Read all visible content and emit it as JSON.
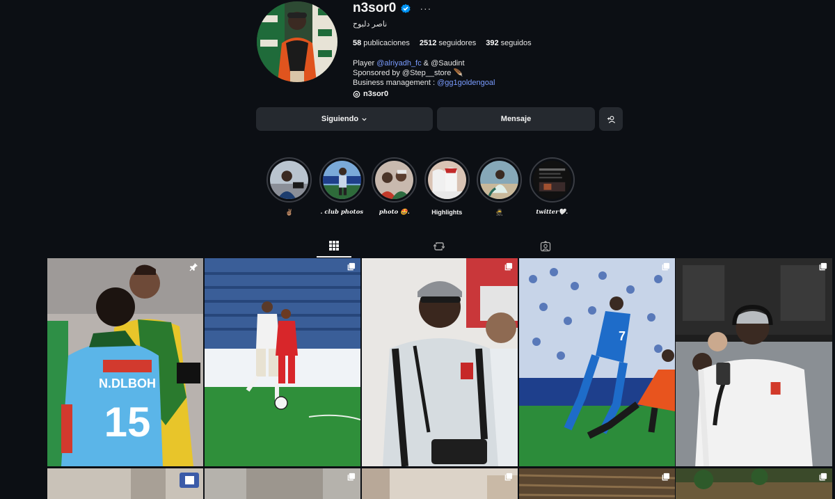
{
  "profile": {
    "username": "n3sor0",
    "verified": true,
    "more_icon": "more-dots-icon",
    "full_name": "ناصر دلبوح",
    "stats": {
      "posts_count": "58",
      "posts_label": "publicaciones",
      "followers_count": "2512",
      "followers_label": "seguidores",
      "following_count": "392",
      "following_label": "seguidos"
    },
    "bio": {
      "line1_prefix": "Player ",
      "line1_mention1": "@alriyadh_fc",
      "line1_mid": " & @Saudint",
      "line2": "Sponsored by @Step__store 🪶",
      "line3_prefix": "Business management : ",
      "line3_mention": "@gg1goldengoal"
    },
    "threads_handle": "n3sor0"
  },
  "actions": {
    "following_label": "Siguiendo",
    "message_label": "Mensaje"
  },
  "highlights": [
    {
      "label": "✌🏽",
      "style": "normal"
    },
    {
      "label": ". club photos",
      "style": "italic"
    },
    {
      "label": "photo 🤩.",
      "style": "italic"
    },
    {
      "label": "Highlights",
      "style": "normal"
    },
    {
      "label": "🥷",
      "style": "normal"
    },
    {
      "label": "twitter🤍.",
      "style": "italic"
    }
  ],
  "tabs": [
    {
      "name": "posts",
      "icon": "grid-icon",
      "active": true
    },
    {
      "name": "reels",
      "icon": "reels-icon",
      "active": false
    },
    {
      "name": "tagged",
      "icon": "tagged-icon",
      "active": false
    }
  ],
  "posts": [
    {
      "badge": "pin-icon"
    },
    {
      "badge": "carousel-icon"
    },
    {
      "badge": "carousel-icon"
    },
    {
      "badge": "carousel-icon"
    },
    {
      "badge": "carousel-icon"
    }
  ],
  "colors": {
    "background": "#0c0f14",
    "button": "#25292f",
    "link": "#7a9cff",
    "verified": "#0095f6"
  }
}
